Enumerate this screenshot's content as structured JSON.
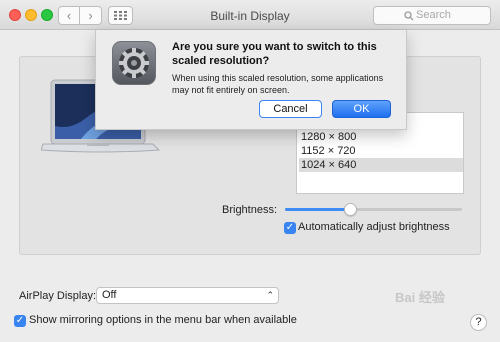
{
  "window": {
    "title": "Built-in Display",
    "search_placeholder": "Search",
    "back_glyph": "‹",
    "forward_glyph": "›"
  },
  "display": {
    "resolutions": [
      "1280 × 800",
      "1152 × 720",
      "1024 × 640"
    ],
    "selected_resolution": "1024 × 640",
    "brightness_label": "Brightness:",
    "brightness_level": 0.37,
    "auto_brightness_label": "Automatically adjust brightness",
    "auto_brightness_checked": true
  },
  "airplay": {
    "label": "AirPlay Display:",
    "selected": "Off"
  },
  "mirroring": {
    "label": "Show mirroring options in the menu bar when available",
    "checked": true
  },
  "help_glyph": "?",
  "watermark": "Bai 经验",
  "dialog": {
    "title": "Are you sure you want to switch to this scaled resolution?",
    "message": "When using this scaled resolution, some applications may not fit entirely on screen.",
    "cancel_label": "Cancel",
    "ok_label": "OK",
    "icon": "gear-icon"
  },
  "colors": {
    "accent": "#3c8cf5",
    "close": "#ff5f57",
    "minimize": "#febc2e",
    "maximize": "#28c840"
  }
}
